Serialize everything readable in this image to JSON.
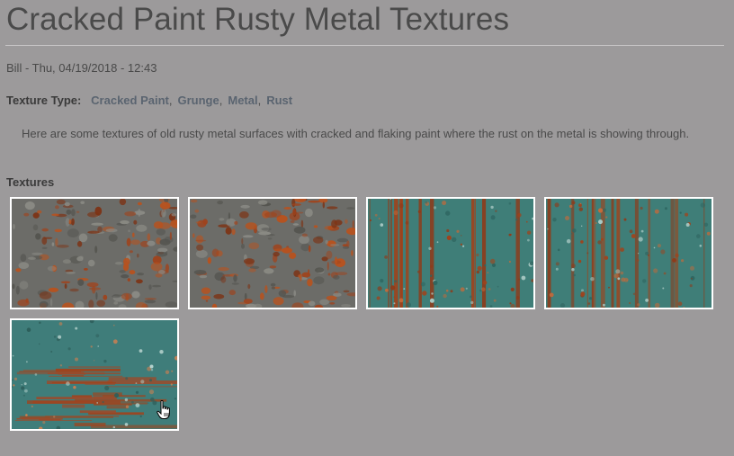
{
  "page": {
    "title": "Cracked Paint Rusty Metal Textures",
    "meta": "Bill - Thu, 04/19/2018 - 12:43",
    "texture_type_label": "Texture Type:",
    "tags": [
      "Cracked Paint",
      "Grunge",
      "Metal",
      "Rust"
    ],
    "description": "Here are some textures of old rusty metal surfaces with cracked and flaking paint where the rust on the metal is showing through.",
    "textures_label": "Textures"
  },
  "thumbnails": [
    {
      "name": "texture-thumb-1",
      "style": "gray-rust"
    },
    {
      "name": "texture-thumb-2",
      "style": "gray-rust"
    },
    {
      "name": "texture-thumb-3",
      "style": "teal-streaks"
    },
    {
      "name": "texture-thumb-4",
      "style": "teal-streaks"
    },
    {
      "name": "texture-thumb-5",
      "style": "teal-scrape"
    }
  ],
  "icons": {
    "cursor": "hand-pointer-icon"
  },
  "colors": {
    "background": "#9c9a9b",
    "title": "#4a4a4a",
    "tag_link": "#5a6470",
    "thumb_border": "#ffffff",
    "rust": "#a0431c",
    "teal_paint": "#3f7e78",
    "gray_metal": "#6c6c68"
  }
}
